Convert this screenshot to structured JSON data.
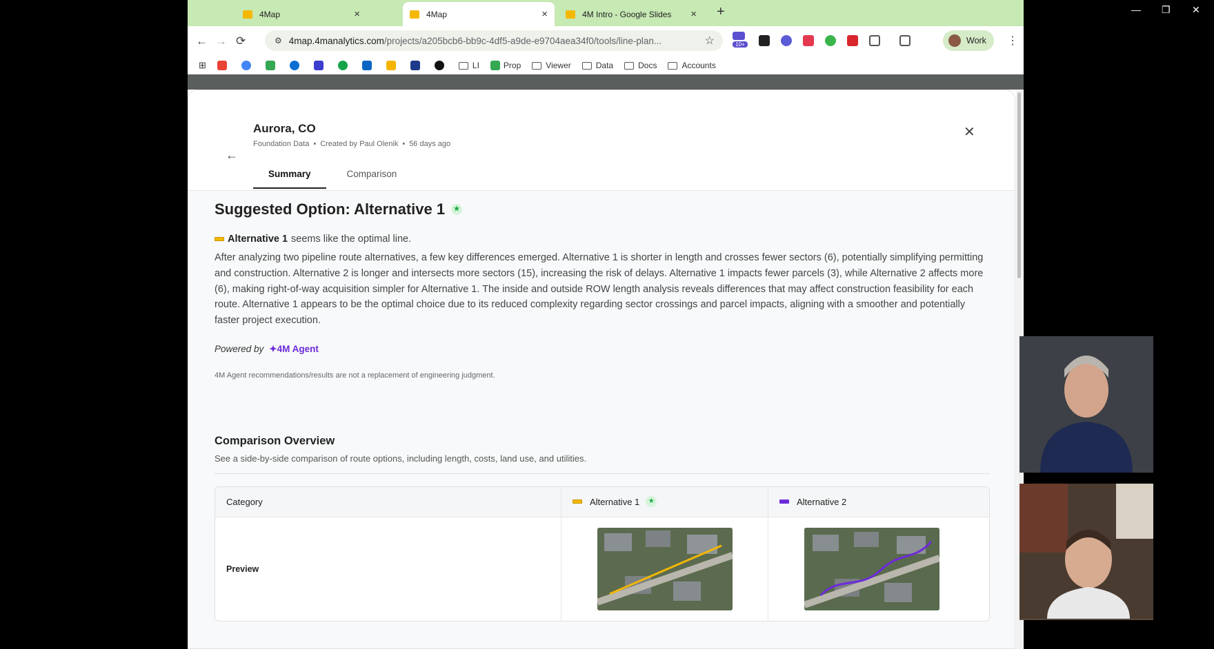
{
  "browser": {
    "tabs": [
      {
        "title": "4Map",
        "active": false
      },
      {
        "title": "4Map",
        "active": true
      },
      {
        "title": "4M Intro - Google Slides",
        "active": false
      }
    ],
    "url_host": "4map.4manalytics.com",
    "url_path": "/projects/a205bcb6-bb9c-4df5-a9de-e9704aea34f0/tools/line-plan...",
    "extensions_badge": "10+",
    "profile_label": "Work",
    "bookmarks": [
      {
        "label": "",
        "icon": "apps-grid-icon"
      },
      {
        "label": "",
        "icon": "gmail-icon"
      },
      {
        "label": "",
        "icon": "google-icon"
      },
      {
        "label": "",
        "icon": "drive-icon"
      },
      {
        "label": "",
        "icon": "cloud-icon"
      },
      {
        "label": "",
        "icon": "shield-icon"
      },
      {
        "label": "",
        "icon": "green-circle-icon"
      },
      {
        "label": "",
        "icon": "linkedin-icon"
      },
      {
        "label": "",
        "icon": "slides-icon"
      },
      {
        "label": "",
        "icon": "plane-icon"
      },
      {
        "label": "",
        "icon": "camera-icon"
      },
      {
        "label": "LI",
        "icon": "folder-icon"
      },
      {
        "label": "Prop",
        "icon": "drive-icon"
      },
      {
        "label": "Viewer",
        "icon": "folder-icon"
      },
      {
        "label": "Data",
        "icon": "folder-icon"
      },
      {
        "label": "Docs",
        "icon": "folder-icon"
      },
      {
        "label": "Accounts",
        "icon": "folder-icon"
      }
    ]
  },
  "header": {
    "title": "Aurora, CO",
    "meta": [
      "Foundation Data",
      "Created by Paul Olenik",
      "56 days ago"
    ],
    "tabs": [
      "Summary",
      "Comparison"
    ]
  },
  "summary": {
    "heading": "Suggested Option: Alternative 1",
    "option_name": "Alternative 1",
    "option_suffix": "seems like the optimal line.",
    "paragraph": "After analyzing two pipeline route alternatives, a few key differences emerged. Alternative 1 is shorter in length and crosses fewer sectors (6), potentially simplifying permitting and construction. Alternative 2 is longer and intersects more sectors (15), increasing the risk of delays. Alternative 1 impacts fewer parcels (3), while Alternative 2 affects more (6), making right-of-way acquisition simpler for Alternative 1. The inside and outside ROW length analysis reveals differences that may affect construction feasibility for each route. Alternative 1 appears to be the optimal choice due to its reduced complexity regarding sector crossings and parcel impacts, aligning with a smoother and potentially faster project execution.",
    "powered_by": "Powered by",
    "agent_name": "4M Agent",
    "disclaimer": "4M Agent recommendations/results are not a replacement of engineering judgment."
  },
  "comparison": {
    "title": "Comparison Overview",
    "subtitle": "See a side-by-side comparison of route options, including length, costs, land use, and utilities.",
    "headers": [
      "Category",
      "Alternative 1",
      "Alternative 2"
    ],
    "rows": [
      {
        "label": "Preview"
      }
    ]
  },
  "colors": {
    "alt1": "#f2b705",
    "alt2": "#6c2bd9",
    "agent": "#6c2bd9",
    "tabstrip": "#c7e9b4"
  }
}
